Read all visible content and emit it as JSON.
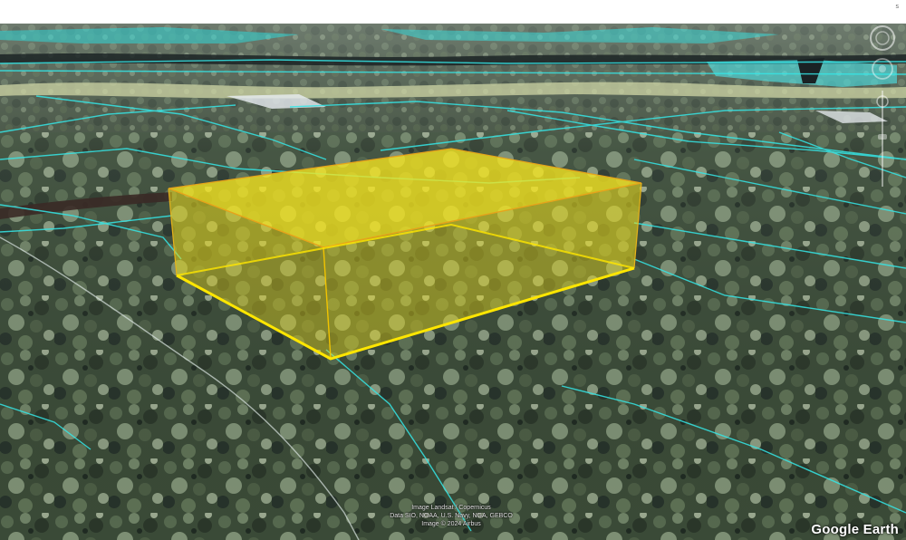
{
  "window": {
    "corner_mark": "s"
  },
  "map": {
    "app_name": "Google Earth",
    "view": "3D tilted satellite view",
    "overlay_color": "#f2e21a",
    "overlay_edge_color": "#ffe600",
    "parcel_line_color": "#35e6e6"
  },
  "attribution": {
    "lines": [
      "Image Landsat / Copernicus",
      "Data SIO, NOAA, U.S. Navy, NGA, GEBCO",
      "Image © 2024 Airbus"
    ]
  },
  "icons": {
    "navigation": "compass-ring-icon",
    "zoom": "zoom-slider-icon"
  }
}
